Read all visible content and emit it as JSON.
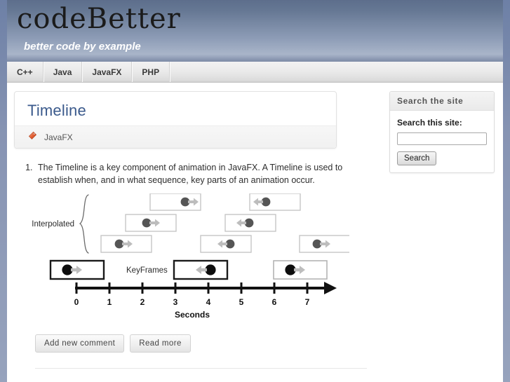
{
  "site": {
    "title": "codeBetter",
    "slogan": "better code by example"
  },
  "nav": {
    "items": [
      {
        "label": "C++"
      },
      {
        "label": "Java"
      },
      {
        "label": "JavaFX"
      },
      {
        "label": "PHP"
      }
    ]
  },
  "node": {
    "title": "Timeline",
    "tag_icon": "tag-icon",
    "tag_label": "JavaFX",
    "body_items": [
      "The Timeline is a key component of animation in JavaFX. A Timeline is used to establish when, and in what sequence, key parts of an animation occur."
    ],
    "links": [
      {
        "label": "Add new comment"
      },
      {
        "label": "Read more"
      }
    ]
  },
  "sidebar": {
    "blocks": [
      {
        "title": "Search the site",
        "label": "Search this site:",
        "input_value": "",
        "input_placeholder": "",
        "submit_label": "Search"
      }
    ]
  },
  "chart_data": {
    "type": "timeline",
    "title": "",
    "xlabel": "Seconds",
    "axis_ticks": [
      0,
      1,
      2,
      3,
      4,
      5,
      6,
      7
    ],
    "xlim": [
      0,
      7
    ],
    "group_label": "Interpolated",
    "keyframes_label": "KeyFrames",
    "colors": {
      "keyframe_border": "#1a1a1a",
      "keyframe_dot": "#0d0d0d",
      "interpolated_border": "#c6c6c6",
      "interpolated_dot": "#555555",
      "arrow": "#bdbdbd",
      "axis": "#111111"
    },
    "rows": [
      {
        "name": "interpolated-row-3",
        "kind": "interpolated",
        "boxes": [
          {
            "start": 1.9,
            "end": 3.3,
            "direction": "right"
          },
          {
            "start": 4.8,
            "end": 6.2,
            "direction": "left"
          }
        ]
      },
      {
        "name": "interpolated-row-2",
        "kind": "interpolated",
        "boxes": [
          {
            "start": 1.2,
            "end": 2.6,
            "direction": "right"
          },
          {
            "start": 4.05,
            "end": 5.45,
            "direction": "left"
          }
        ]
      },
      {
        "name": "interpolated-row-1",
        "kind": "interpolated",
        "boxes": [
          {
            "start": 0.5,
            "end": 1.9,
            "direction": "right"
          },
          {
            "start": 3.35,
            "end": 4.75,
            "direction": "left"
          },
          {
            "start": 6.1,
            "end": 7.5,
            "direction": "right"
          }
        ]
      },
      {
        "name": "keyframes-row",
        "kind": "keyframe",
        "boxes": [
          {
            "start": -0.35,
            "end": 1.05,
            "direction": "right",
            "emphasis": true
          },
          {
            "start": 2.3,
            "end": 3.7,
            "direction": "left",
            "emphasis": true
          },
          {
            "start": 4.95,
            "end": 6.35,
            "direction": "right",
            "emphasis": false
          }
        ]
      }
    ]
  }
}
